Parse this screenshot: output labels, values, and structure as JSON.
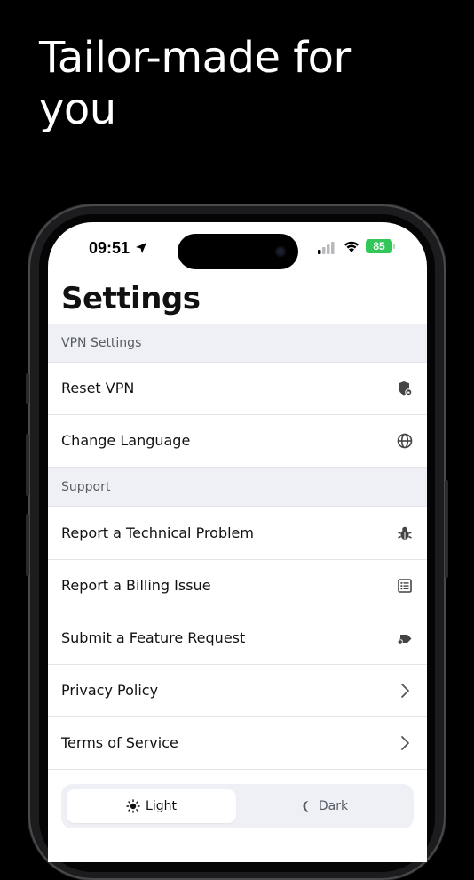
{
  "headline": {
    "line1": "Tailor-made for",
    "line2": "you"
  },
  "status_bar": {
    "time": "09:51",
    "battery": "85"
  },
  "settings": {
    "title": "Settings",
    "sections": [
      {
        "header": "VPN Settings",
        "items": [
          {
            "label": "Reset VPN",
            "icon": "shield-icon"
          },
          {
            "label": "Change Language",
            "icon": "globe-icon"
          }
        ]
      },
      {
        "header": "Support",
        "items": [
          {
            "label": "Report a Technical Problem",
            "icon": "bug-icon"
          },
          {
            "label": "Report a Billing Issue",
            "icon": "receipt-icon"
          },
          {
            "label": "Submit a Feature Request",
            "icon": "feature-icon"
          },
          {
            "label": "Privacy Policy",
            "icon": "chevron-right-icon"
          },
          {
            "label": "Terms of Service",
            "icon": "chevron-right-icon"
          }
        ]
      }
    ]
  },
  "theme": {
    "light_label": "Light",
    "dark_label": "Dark",
    "selected": "Light"
  },
  "colors": {
    "accent_battery": "#33c759",
    "section_bg": "#eef0f5",
    "text": "#111111"
  }
}
